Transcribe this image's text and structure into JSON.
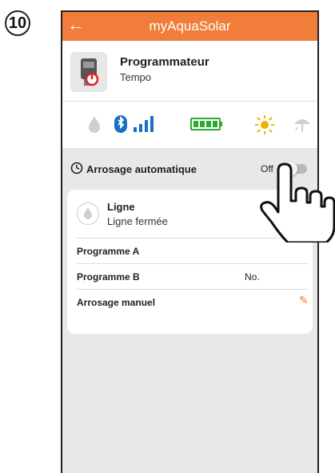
{
  "step_number": "10",
  "app": {
    "title": "myAquaSolar",
    "back_icon": "arrow-left-icon"
  },
  "device": {
    "name": "Programmateur",
    "subtitle": "Tempo",
    "icon": "programmer-device-icon"
  },
  "status_icons": [
    "water-drop-icon",
    "bluetooth-icon",
    "signal-bars-icon",
    "battery-full-icon",
    "sun-icon",
    "rain-umbrella-icon"
  ],
  "auto_watering": {
    "label": "Arrosage automatique",
    "state": "Off"
  },
  "line": {
    "title": "Ligne",
    "status": "Ligne fermée"
  },
  "programs": [
    {
      "label": "Programme A",
      "value": ""
    },
    {
      "label": "Programme B",
      "value": "No."
    }
  ],
  "manual": {
    "label": "Arrosage manuel"
  },
  "colors": {
    "accent": "#f07d3a",
    "bluetooth": "#1a6fc4",
    "battery": "#2eaa2e",
    "sun": "#e8b400"
  }
}
